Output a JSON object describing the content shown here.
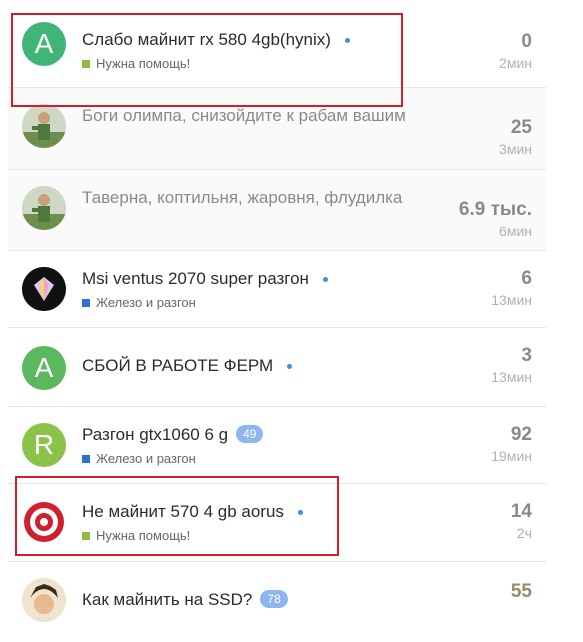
{
  "topics": [
    {
      "avatar_letter": "A",
      "avatar_color": "#3fb678",
      "title": "Слабо майнит rx 580 4gb(hynix)",
      "unread": true,
      "tag": "Нужна помощь!",
      "tag_color": "#8fbd3b",
      "count": "0",
      "time": "2мин",
      "muted": false
    },
    {
      "avatar_icon": "soldier-avatar-icon",
      "title": "Боги олимпа, снизойдите к рабам вашим",
      "unread": false,
      "tag": "",
      "count": "25",
      "time": "3мин",
      "muted": true
    },
    {
      "avatar_icon": "soldier-avatar-icon",
      "title": "Таверна, коптильня, жаровня, флудилка",
      "unread": false,
      "tag": "",
      "count": "6.9 тыс.",
      "time": "6мин",
      "muted": true
    },
    {
      "avatar_icon": "gem-avatar-icon",
      "title": "Msi ventus 2070 super разгон",
      "unread": true,
      "tag": "Железо и разгон",
      "tag_color": "#2f6fd6",
      "count": "6",
      "time": "13мин",
      "muted": false
    },
    {
      "avatar_letter": "A",
      "avatar_color": "#5cb85c",
      "title": "СБОЙ В РАБОТЕ ФЕРМ",
      "unread": true,
      "tag": "",
      "count": "3",
      "time": "13мин",
      "muted": false
    },
    {
      "avatar_letter": "R",
      "avatar_color": "#8bc34a",
      "title": "Разгон gtx1060 6 g",
      "badge": "49",
      "unread": false,
      "tag": "Железо и разгон",
      "tag_color": "#2f6fd6",
      "count": "92",
      "time": "19мин",
      "muted": false
    },
    {
      "avatar_icon": "target-avatar-icon",
      "title": "Не майнит 570 4 gb aorus",
      "unread": true,
      "tag": "Нужна помощь!",
      "tag_color": "#8fbd3b",
      "count": "14",
      "time": "2ч",
      "muted": false
    },
    {
      "avatar_icon": "cartoon-avatar-icon",
      "title": "Как майнить на SSD?",
      "badge": "78",
      "unread": false,
      "tag": "",
      "count": "55",
      "time": "",
      "muted": false
    }
  ]
}
